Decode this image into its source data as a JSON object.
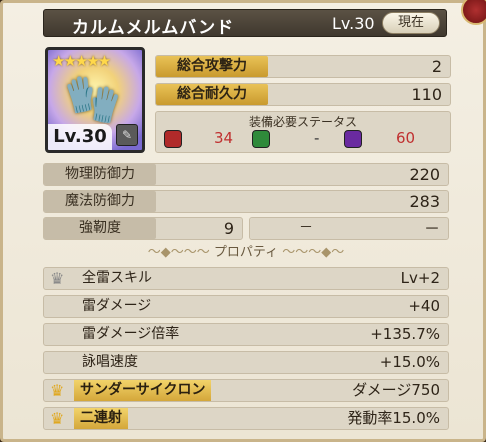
{
  "header": {
    "item_name": "カルムメルムバンド",
    "level": "Lv.30",
    "current_button": "現在"
  },
  "card": {
    "stars": "★★★★★",
    "level": "Lv.30"
  },
  "stats_main": [
    {
      "label": "総合攻撃力",
      "value": "2"
    },
    {
      "label": "総合耐久力",
      "value": "110"
    }
  ],
  "requirements": {
    "title": "装備必要ステータス",
    "items": [
      {
        "icon": "fist-icon",
        "value": "34",
        "color": "#d03030"
      },
      {
        "icon": "green-plus-icon",
        "value": "-",
        "color": "#2f9a3a"
      },
      {
        "icon": "magic-wand-icon",
        "value": "60",
        "color": "#7a3ab0"
      }
    ]
  },
  "stats_defense": [
    {
      "label": "物理防御力",
      "value": "220"
    },
    {
      "label": "魔法防御力",
      "value": "283"
    }
  ],
  "toughness": {
    "label": "強靭度",
    "value": "9",
    "extra1": "－",
    "extra2": "－"
  },
  "divider_label": "プロパティ",
  "properties": [
    {
      "label": "全雷スキル",
      "value": "Lv+2",
      "crown": "silver"
    },
    {
      "label": "雷ダメージ",
      "value": "+40",
      "crown": ""
    },
    {
      "label": "雷ダメージ倍率",
      "value": "+135.7%",
      "crown": ""
    },
    {
      "label": "詠唱速度",
      "value": "+15.0%",
      "crown": ""
    },
    {
      "label": "サンダーサイクロン",
      "value": "ダメージ750",
      "crown": "gold"
    },
    {
      "label": "二連射",
      "value": "発動率15.0%",
      "crown": "gold"
    }
  ]
}
